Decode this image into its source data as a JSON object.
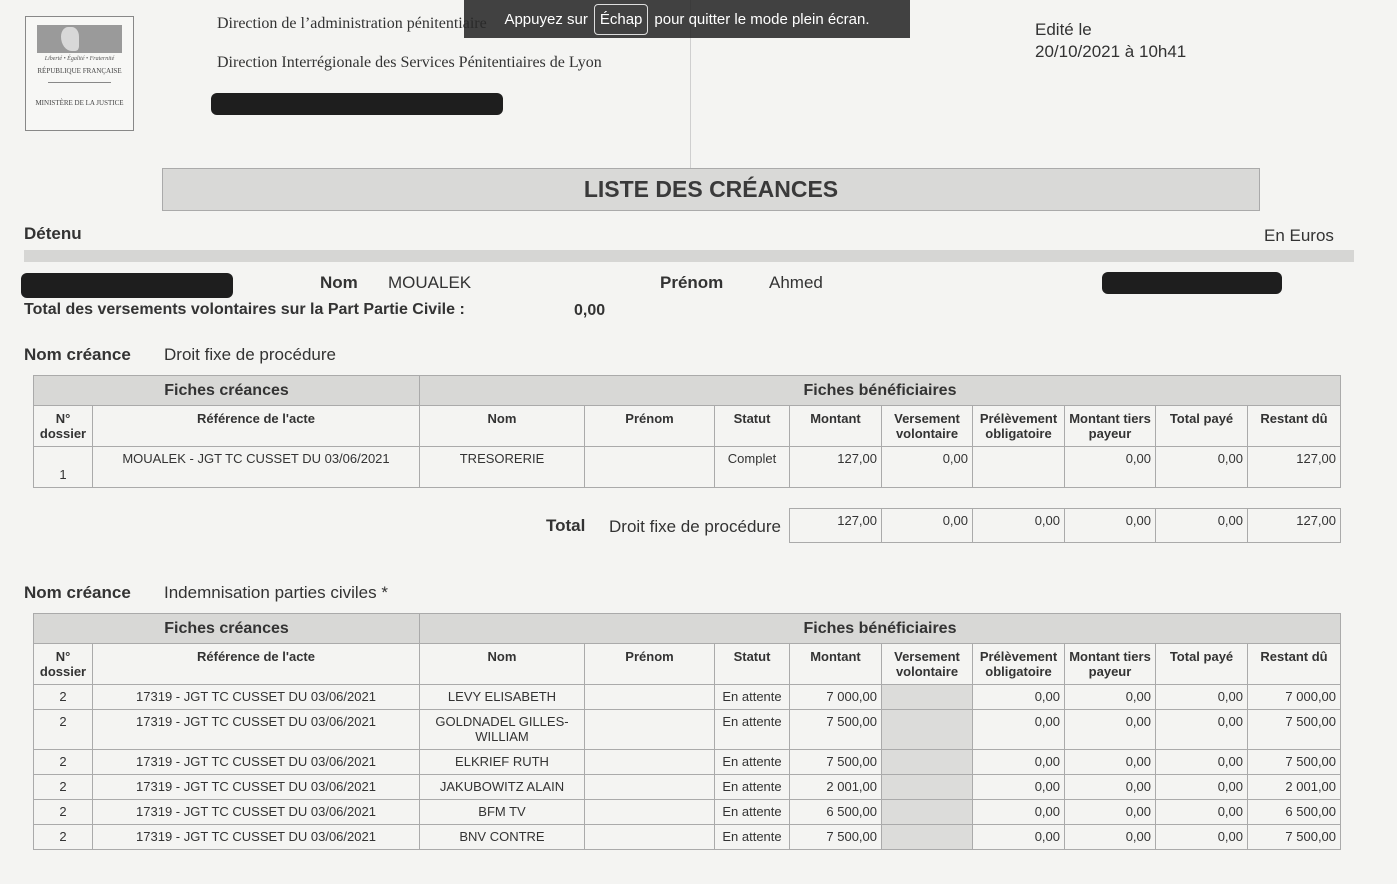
{
  "logo": {
    "motto": "Liberté • Égalité • Fraternité",
    "republic": "RÉPUBLIQUE FRANÇAISE",
    "ministry": "MINISTÈRE DE LA JUSTICE"
  },
  "header": {
    "line1": "Direction de l’administration pénitentiaire",
    "line2": "Direction Interrégionale des Services Pénitentiaires de Lyon",
    "edited_label": "Edité le",
    "edited_date": "20/10/2021 à 10h41"
  },
  "fullscreen_notice": {
    "before": "Appuyez sur",
    "key": "Échap",
    "after": "pour quitter le mode plein écran."
  },
  "title": "LISTE DES CRÉANCES",
  "detenu": {
    "section_label": "Détenu",
    "currency": "En Euros",
    "nom_label": "Nom",
    "nom": "MOUALEK",
    "prenom_label": "Prénom",
    "prenom": "Ahmed",
    "total_vv_label": "Total des versements volontaires sur la Part Partie Civile :",
    "total_vv": "0,00"
  },
  "table_headers": {
    "group_fiches": "Fiches créances",
    "group_benef": "Fiches bénéficiaires",
    "cols": [
      "N° dossier",
      "Référence de l'acte",
      "Nom",
      "Prénom",
      "Statut",
      "Montant",
      "Versement volontaire",
      "Prélèvement obligatoire",
      "Montant tiers payeur",
      "Total payé",
      "Restant dû"
    ]
  },
  "creance1": {
    "label": "Nom créance",
    "name": "Droit fixe de procédure",
    "rows": [
      {
        "dossier": "1",
        "ref": "MOUALEK - JGT TC CUSSET DU 03/06/2021",
        "nom": "TRESORERIE",
        "prenom": "",
        "statut": "Complet",
        "montant": "127,00",
        "vv": "0,00",
        "po": "",
        "mtp": "0,00",
        "paye": "0,00",
        "restant": "127,00"
      }
    ],
    "total": {
      "label": "Total",
      "name": "Droit fixe de procédure",
      "montant": "127,00",
      "vv": "0,00",
      "po": "0,00",
      "mtp": "0,00",
      "paye": "0,00",
      "restant": "127,00"
    }
  },
  "creance2": {
    "label": "Nom créance",
    "name": "Indemnisation parties civiles *",
    "rows": [
      {
        "dossier": "2",
        "ref": "17319 - JGT TC CUSSET DU 03/06/2021",
        "nom": "LEVY ELISABETH",
        "prenom": "",
        "statut": "En attente",
        "montant": "7 000,00",
        "vv": "",
        "po": "0,00",
        "mtp": "0,00",
        "paye": "0,00",
        "restant": "7 000,00"
      },
      {
        "dossier": "2",
        "ref": "17319 - JGT TC CUSSET DU 03/06/2021",
        "nom": "GOLDNADEL GILLES-WILLIAM",
        "prenom": "",
        "statut": "En attente",
        "montant": "7 500,00",
        "vv": "",
        "po": "0,00",
        "mtp": "0,00",
        "paye": "0,00",
        "restant": "7 500,00"
      },
      {
        "dossier": "2",
        "ref": "17319 - JGT TC CUSSET DU 03/06/2021",
        "nom": "ELKRIEF RUTH",
        "prenom": "",
        "statut": "En attente",
        "montant": "7 500,00",
        "vv": "",
        "po": "0,00",
        "mtp": "0,00",
        "paye": "0,00",
        "restant": "7 500,00"
      },
      {
        "dossier": "2",
        "ref": "17319 - JGT TC CUSSET DU 03/06/2021",
        "nom": "JAKUBOWITZ ALAIN",
        "prenom": "",
        "statut": "En attente",
        "montant": "2 001,00",
        "vv": "",
        "po": "0,00",
        "mtp": "0,00",
        "paye": "0,00",
        "restant": "2 001,00"
      },
      {
        "dossier": "2",
        "ref": "17319 - JGT TC CUSSET DU 03/06/2021",
        "nom": "BFM TV",
        "prenom": "",
        "statut": "En attente",
        "montant": "6 500,00",
        "vv": "",
        "po": "0,00",
        "mtp": "0,00",
        "paye": "0,00",
        "restant": "6 500,00"
      },
      {
        "dossier": "2",
        "ref": "17319 - JGT TC CUSSET DU 03/06/2021",
        "nom": "BNV CONTRE",
        "prenom": "",
        "statut": "En attente",
        "montant": "7 500,00",
        "vv": "",
        "po": "0,00",
        "mtp": "0,00",
        "paye": "0,00",
        "restant": "7 500,00"
      }
    ]
  }
}
